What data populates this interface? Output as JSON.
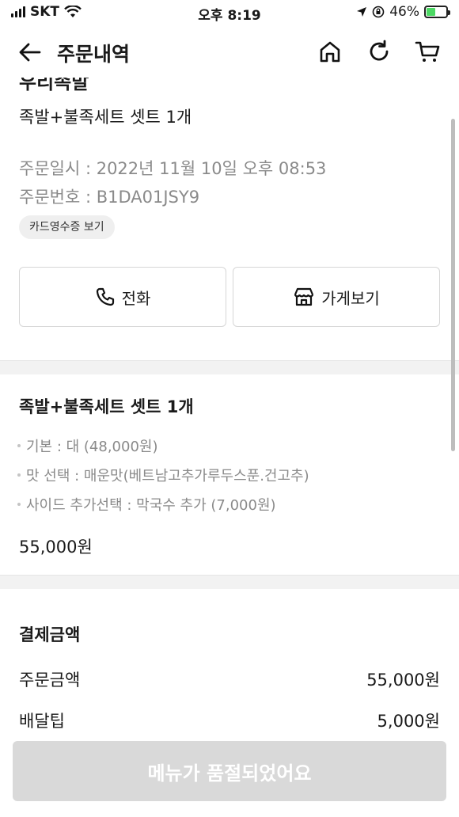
{
  "status_bar": {
    "carrier": "SKT",
    "time": "오후 8:19",
    "battery": "46%",
    "battery_level": 0.46
  },
  "header": {
    "title": "주문내역",
    "icons": [
      "back-arrow-icon",
      "home-icon",
      "refresh-icon",
      "cart-icon"
    ]
  },
  "store": {
    "name_cut": "우리족발",
    "menu_summary": "족발+불족세트 셋트 1개",
    "order_datetime": "주문일시 : 2022년 11월 10일 오후 08:53",
    "order_number": "주문번호 : B1DA01JSY9",
    "receipt_label": "카드영수증 보기",
    "call_label": "전화",
    "store_label": "가게보기"
  },
  "menu": {
    "title": "족발+불족세트 셋트 1개",
    "options": [
      "기본 : 대 (48,000원)",
      "맛 선택 : 매운맛(베트남고추가루두스푼.건고추)",
      "사이드 추가선택 : 막국수 추가 (7,000원)"
    ],
    "price": "55,000원"
  },
  "payment": {
    "title": "결제금액",
    "rows": [
      {
        "label": "주문금액",
        "value": "55,000원"
      },
      {
        "label": "배달팁",
        "value": "5,000원"
      }
    ]
  },
  "bottom_button": "메뉴가 품절되었어요"
}
